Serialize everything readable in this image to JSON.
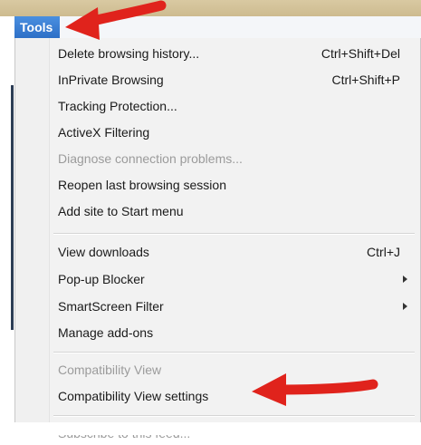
{
  "menubar": {
    "tools_label": "Tools"
  },
  "menu": {
    "group1": [
      {
        "label": "Delete browsing history...",
        "shortcut": "Ctrl+Shift+Del"
      },
      {
        "label": "InPrivate Browsing",
        "shortcut": "Ctrl+Shift+P"
      },
      {
        "label": "Tracking Protection..."
      },
      {
        "label": "ActiveX Filtering"
      },
      {
        "label": "Diagnose connection problems...",
        "disabled": true
      },
      {
        "label": "Reopen last browsing session"
      },
      {
        "label": "Add site to Start menu"
      }
    ],
    "group2": [
      {
        "label": "View downloads",
        "shortcut": "Ctrl+J"
      },
      {
        "label": "Pop-up Blocker",
        "submenu": true
      },
      {
        "label": "SmartScreen Filter",
        "submenu": true
      },
      {
        "label": "Manage add-ons"
      }
    ],
    "group3": [
      {
        "label": "Compatibility View",
        "disabled": true
      },
      {
        "label": "Compatibility View settings"
      }
    ],
    "group4": [
      {
        "label": "Subscribe to this feed...",
        "disabled": true
      }
    ]
  },
  "annotations": {
    "arrow_color": "#e0231c"
  }
}
